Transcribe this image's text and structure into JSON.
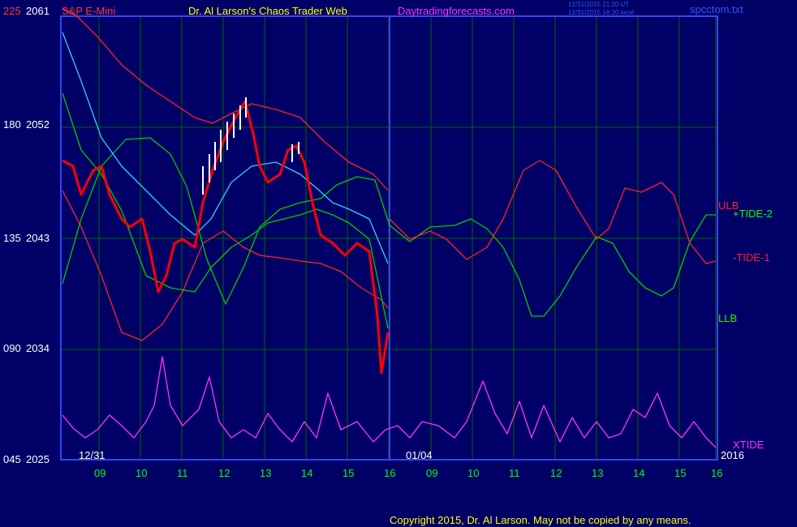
{
  "header": {
    "symbol": "S&P E-Mini",
    "title": "Dr. Al Larson's Chaos Trader Web",
    "site": "Daytradingforecasts.com",
    "stamp1": "12/31/2015 21:20 UT",
    "stamp2": "12/31/2015 16:20 local",
    "file": "spcctom.txt"
  },
  "footer": {
    "copyright": "Copyright 2015, Dr. Al Larson. May not be copied by any means."
  },
  "colors": {
    "background": "#000066",
    "grid": "#006600",
    "frame": "#3344ff",
    "price": "#ff0000",
    "price_bar": "#ffffff",
    "upper": "#ff2222",
    "cyan": "#33ccff",
    "green": "#00cc00",
    "yellow": "#ffff00",
    "xtide": "#ff33ff"
  },
  "chart_data": {
    "type": "line",
    "left_axis_labels": [
      "225",
      "180",
      "135",
      "090",
      "045"
    ],
    "right_price_labels": [
      "2061",
      "2052",
      "2043",
      "2034",
      "2025"
    ],
    "y_range_price": [
      2025,
      2061
    ],
    "x_tick_labels": [
      "09",
      "10",
      "11",
      "12",
      "13",
      "14",
      "15",
      "16",
      "09",
      "10",
      "11",
      "12",
      "13",
      "14",
      "15",
      "16"
    ],
    "date_markers": [
      "12/31",
      "01/04",
      "2016"
    ],
    "series": [
      {
        "name": "ULB",
        "color": "#ff2222",
        "points": [
          [
            77,
            10
          ],
          [
            95,
            20
          ],
          [
            120,
            45
          ],
          [
            150,
            80
          ],
          [
            180,
            105
          ],
          [
            210,
            125
          ],
          [
            240,
            145
          ],
          [
            262,
            152
          ],
          [
            285,
            140
          ],
          [
            310,
            128
          ],
          [
            340,
            135
          ],
          [
            370,
            145
          ],
          [
            400,
            175
          ],
          [
            430,
            200
          ],
          [
            460,
            215
          ],
          [
            478,
            235
          ]
        ]
      },
      {
        "name": "LLB",
        "color": "#ff2222",
        "points": [
          [
            77,
            235
          ],
          [
            100,
            280
          ],
          [
            125,
            340
          ],
          [
            150,
            410
          ],
          [
            175,
            420
          ],
          [
            200,
            400
          ],
          [
            225,
            360
          ],
          [
            250,
            300
          ],
          [
            275,
            285
          ],
          [
            300,
            305
          ],
          [
            320,
            315
          ],
          [
            345,
            318
          ],
          [
            370,
            322
          ],
          [
            395,
            325
          ],
          [
            420,
            335
          ],
          [
            445,
            355
          ],
          [
            470,
            370
          ],
          [
            478,
            380
          ]
        ]
      },
      {
        "name": "+TIDE-2",
        "color": "#00cc00",
        "points": [
          [
            77,
            350
          ],
          [
            100,
            270
          ],
          [
            125,
            205
          ],
          [
            155,
            172
          ],
          [
            185,
            170
          ],
          [
            210,
            190
          ],
          [
            230,
            230
          ],
          [
            255,
            320
          ],
          [
            278,
            375
          ],
          [
            300,
            330
          ],
          [
            320,
            280
          ],
          [
            345,
            258
          ],
          [
            370,
            250
          ],
          [
            395,
            245
          ],
          [
            415,
            228
          ],
          [
            440,
            218
          ],
          [
            462,
            222
          ],
          [
            480,
            278
          ],
          [
            505,
            298
          ],
          [
            530,
            280
          ],
          [
            560,
            278
          ],
          [
            580,
            270
          ],
          [
            600,
            282
          ],
          [
            620,
            305
          ],
          [
            640,
            345
          ],
          [
            655,
            390
          ],
          [
            670,
            390
          ],
          [
            690,
            365
          ],
          [
            710,
            330
          ],
          [
            735,
            292
          ],
          [
            755,
            300
          ],
          [
            775,
            335
          ],
          [
            795,
            355
          ],
          [
            815,
            365
          ],
          [
            830,
            355
          ],
          [
            850,
            298
          ],
          [
            870,
            265
          ],
          [
            882,
            265
          ]
        ]
      },
      {
        "name": "-TIDE-1",
        "color": "#ff2222",
        "points": [
          [
            480,
            270
          ],
          [
            505,
            295
          ],
          [
            530,
            285
          ],
          [
            550,
            295
          ],
          [
            575,
            320
          ],
          [
            600,
            305
          ],
          [
            620,
            270
          ],
          [
            645,
            210
          ],
          [
            665,
            198
          ],
          [
            685,
            210
          ],
          [
            710,
            255
          ],
          [
            735,
            295
          ],
          [
            750,
            282
          ],
          [
            770,
            232
          ],
          [
            790,
            237
          ],
          [
            815,
            225
          ],
          [
            830,
            240
          ],
          [
            850,
            300
          ],
          [
            870,
            325
          ],
          [
            882,
            322
          ]
        ]
      },
      {
        "name": "cyan",
        "color": "#33ccff",
        "points": [
          [
            77,
            40
          ],
          [
            100,
            100
          ],
          [
            125,
            170
          ],
          [
            150,
            205
          ],
          [
            180,
            235
          ],
          [
            210,
            265
          ],
          [
            240,
            290
          ],
          [
            260,
            270
          ],
          [
            285,
            225
          ],
          [
            310,
            205
          ],
          [
            340,
            200
          ],
          [
            370,
            215
          ],
          [
            390,
            232
          ],
          [
            410,
            250
          ],
          [
            430,
            258
          ],
          [
            455,
            270
          ],
          [
            478,
            325
          ]
        ]
      },
      {
        "name": "green2",
        "color": "#00cc00",
        "points": [
          [
            77,
            115
          ],
          [
            100,
            185
          ],
          [
            125,
            215
          ],
          [
            150,
            260
          ],
          [
            180,
            340
          ],
          [
            210,
            355
          ],
          [
            240,
            360
          ],
          [
            260,
            330
          ],
          [
            285,
            305
          ],
          [
            310,
            290
          ],
          [
            330,
            275
          ],
          [
            350,
            270
          ],
          [
            370,
            265
          ],
          [
            390,
            258
          ],
          [
            410,
            265
          ],
          [
            430,
            275
          ],
          [
            455,
            295
          ],
          [
            478,
            405
          ]
        ]
      },
      {
        "name": "XTIDE",
        "color": "#ff33ff",
        "points": [
          [
            77,
            512
          ],
          [
            90,
            528
          ],
          [
            105,
            540
          ],
          [
            120,
            530
          ],
          [
            135,
            512
          ],
          [
            150,
            525
          ],
          [
            165,
            540
          ],
          [
            180,
            520
          ],
          [
            190,
            500
          ],
          [
            200,
            440
          ],
          [
            210,
            500
          ],
          [
            225,
            525
          ],
          [
            245,
            505
          ],
          [
            258,
            465
          ],
          [
            270,
            520
          ],
          [
            285,
            540
          ],
          [
            300,
            530
          ],
          [
            315,
            540
          ],
          [
            330,
            510
          ],
          [
            345,
            530
          ],
          [
            360,
            545
          ],
          [
            375,
            520
          ],
          [
            390,
            540
          ],
          [
            404,
            485
          ],
          [
            420,
            530
          ],
          [
            440,
            520
          ],
          [
            460,
            545
          ],
          [
            475,
            530
          ],
          [
            490,
            525
          ],
          [
            505,
            540
          ],
          [
            520,
            520
          ],
          [
            540,
            525
          ],
          [
            560,
            540
          ],
          [
            575,
            520
          ],
          [
            595,
            470
          ],
          [
            610,
            510
          ],
          [
            625,
            535
          ],
          [
            640,
            495
          ],
          [
            655,
            540
          ],
          [
            670,
            500
          ],
          [
            690,
            545
          ],
          [
            705,
            515
          ],
          [
            720,
            540
          ],
          [
            735,
            520
          ],
          [
            750,
            540
          ],
          [
            765,
            535
          ],
          [
            780,
            505
          ],
          [
            795,
            515
          ],
          [
            810,
            485
          ],
          [
            825,
            525
          ],
          [
            840,
            540
          ],
          [
            855,
            520
          ],
          [
            870,
            540
          ],
          [
            882,
            552
          ]
        ]
      },
      {
        "name": "price",
        "color": "#ff0000",
        "points": [
          [
            77,
            198
          ],
          [
            90,
            205
          ],
          [
            100,
            240
          ],
          [
            115,
            210
          ],
          [
            125,
            205
          ],
          [
            135,
            240
          ],
          [
            150,
            270
          ],
          [
            160,
            280
          ],
          [
            175,
            270
          ],
          [
            185,
            310
          ],
          [
            195,
            360
          ],
          [
            205,
            340
          ],
          [
            215,
            300
          ],
          [
            225,
            295
          ],
          [
            240,
            305
          ],
          [
            250,
            250
          ],
          [
            262,
            210
          ],
          [
            275,
            175
          ],
          [
            290,
            145
          ],
          [
            302,
            125
          ],
          [
            312,
            165
          ],
          [
            320,
            205
          ],
          [
            330,
            225
          ],
          [
            345,
            215
          ],
          [
            355,
            185
          ],
          [
            365,
            180
          ],
          [
            375,
            200
          ],
          [
            385,
            250
          ],
          [
            395,
            290
          ],
          [
            410,
            300
          ],
          [
            425,
            315
          ],
          [
            440,
            300
          ],
          [
            455,
            310
          ],
          [
            465,
            390
          ],
          [
            470,
            460
          ],
          [
            478,
            410
          ]
        ]
      }
    ],
    "line_labels": [
      "ULB",
      "+TIDE-2",
      "-TIDE-1",
      "LLB",
      "XTIDE"
    ]
  }
}
